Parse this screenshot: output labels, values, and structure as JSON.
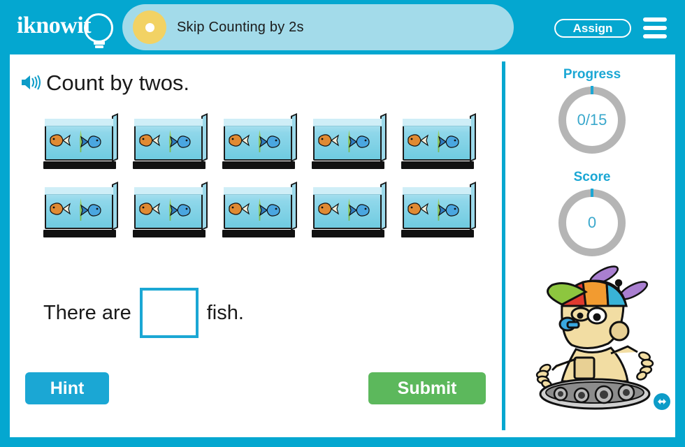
{
  "brand": {
    "logo_text": "iknowit",
    "logo_icon": "lightbulb-icon"
  },
  "header": {
    "lesson_title": "Skip Counting by 2s",
    "lesson_dot_icon": "lesson-dot-icon",
    "assign_label": "Assign",
    "menu_icon": "hamburger-menu-icon"
  },
  "question": {
    "audio_icon": "speaker-icon",
    "prompt": "Count by twos."
  },
  "manipulatives": {
    "item_icon": "fish-tank-icon",
    "rows": [
      [
        "fish-tank",
        "fish-tank",
        "fish-tank",
        "fish-tank",
        "fish-tank"
      ],
      [
        "fish-tank",
        "fish-tank",
        "fish-tank",
        "fish-tank",
        "fish-tank"
      ]
    ],
    "tank_count": 10,
    "fish_per_tank": 2
  },
  "answer": {
    "prefix": "There are",
    "suffix": "fish.",
    "value": "",
    "placeholder": ""
  },
  "actions": {
    "hint_label": "Hint",
    "submit_label": "Submit"
  },
  "sidebar": {
    "progress": {
      "label": "Progress",
      "value": "0/15"
    },
    "score": {
      "label": "Score",
      "value": "0"
    },
    "mascot_icon": "robot-mascot-icon",
    "nav_icon": "resize-arrows-icon"
  },
  "colors": {
    "brand_cyan": "#04a7d0",
    "accent_cyan": "#1ba7d4",
    "tab_blue": "#a3dbea",
    "tab_dot_gold": "#f2d264",
    "submit_green": "#5cb85c",
    "ring_gray": "#b5b5b5",
    "text_dark": "#1a1a1a"
  }
}
